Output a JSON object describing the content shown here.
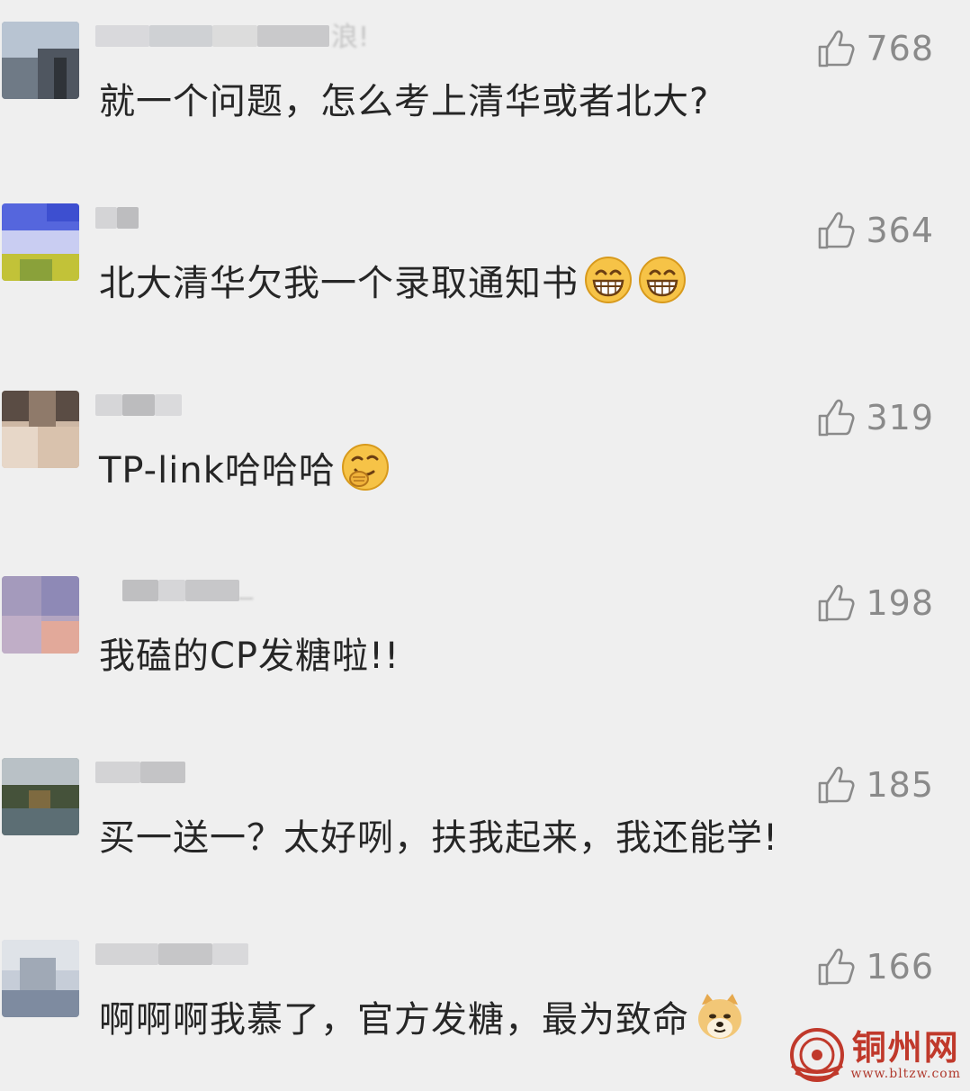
{
  "comments": [
    {
      "username_tail": "浪!",
      "text": "就一个问题，怎么考上清华或者北大?",
      "likes": "768",
      "emojis": []
    },
    {
      "username_tail": "",
      "text": "北大清华欠我一个录取通知书",
      "likes": "364",
      "emojis": [
        "grin-emoji",
        "grin-emoji"
      ]
    },
    {
      "username_tail": "",
      "text": "TP-link哈哈哈",
      "likes": "319",
      "emojis": [
        "giggle-emoji"
      ]
    },
    {
      "username_tail": "_",
      "text": "我磕的CP发糖啦!!",
      "likes": "198",
      "emojis": []
    },
    {
      "username_tail": "",
      "text": "买一送一？太好咧，扶我起来，我还能学!",
      "likes": "185",
      "emojis": []
    },
    {
      "username_tail": "",
      "text": "啊啊啊我慕了，官方发糖，最为致命",
      "likes": "166",
      "emojis": [
        "doge-emoji"
      ]
    }
  ],
  "watermark": {
    "name": "铜州网",
    "url": "www.bltzw.com"
  },
  "colors": {
    "background": "#efefef",
    "text": "#262626",
    "like": "#8a8a8a",
    "watermark": "#c0392b"
  }
}
